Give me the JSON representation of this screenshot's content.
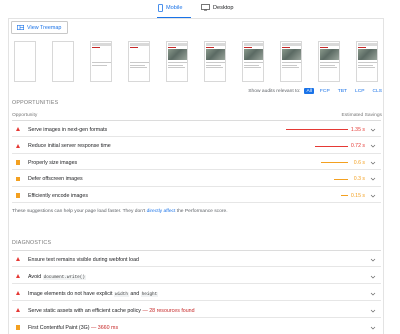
{
  "tabs": [
    {
      "label": "Mobile",
      "icon": "mobile-icon",
      "active": true
    },
    {
      "label": "Desktop",
      "icon": "desktop-icon",
      "active": false
    }
  ],
  "treemap_button": {
    "label": "View Treemap",
    "icon": "treemap-icon"
  },
  "filmstrip": {
    "frames": 10
  },
  "filter": {
    "label": "Show audits relevant to:",
    "chips": [
      "All",
      "FCP",
      "TBT",
      "LCP",
      "CLS"
    ]
  },
  "opportunities": {
    "title": "OPPORTUNITIES",
    "col_opportunity": "Opportunity",
    "col_savings": "Estimated Savings",
    "items": [
      {
        "label": "Serve images in next-gen formats",
        "value": "1.35 s",
        "severity": "fail",
        "savings_fraction": 1.0
      },
      {
        "label": "Reduce initial server response time",
        "value": "0.72 s",
        "severity": "fail",
        "savings_fraction": 0.53
      },
      {
        "label": "Properly size images",
        "value": "0.6 s",
        "severity": "average",
        "savings_fraction": 0.44
      },
      {
        "label": "Defer offscreen images",
        "value": "0.3 s",
        "severity": "average",
        "savings_fraction": 0.22
      },
      {
        "label": "Efficiently encode images",
        "value": "0.15 s",
        "severity": "average",
        "savings_fraction": 0.11
      }
    ],
    "note_prefix": "These suggestions can help your page load faster. They don't",
    "note_link": "directly affect",
    "note_suffix": "the Performance score."
  },
  "diagnostics": {
    "title": "DIAGNOSTICS",
    "items": [
      {
        "label": "Ensure text remains visible during webfont load",
        "severity": "fail"
      },
      {
        "label": "Avoid",
        "code": "document.write()",
        "severity": "fail"
      },
      {
        "label": "Image elements do not have explicit",
        "code": "width",
        "label2": "and",
        "code2": "height",
        "severity": "fail"
      },
      {
        "label": "Serve static assets with an efficient cache policy",
        "extra": "— 28 resources found",
        "severity": "fail"
      },
      {
        "label": "First Contentful Paint (3G)",
        "extra": "— 3660 ms",
        "severity": "average"
      }
    ]
  },
  "colors": {
    "fail": "#e53935",
    "average": "#f3a020",
    "accent": "#1a73e8"
  }
}
